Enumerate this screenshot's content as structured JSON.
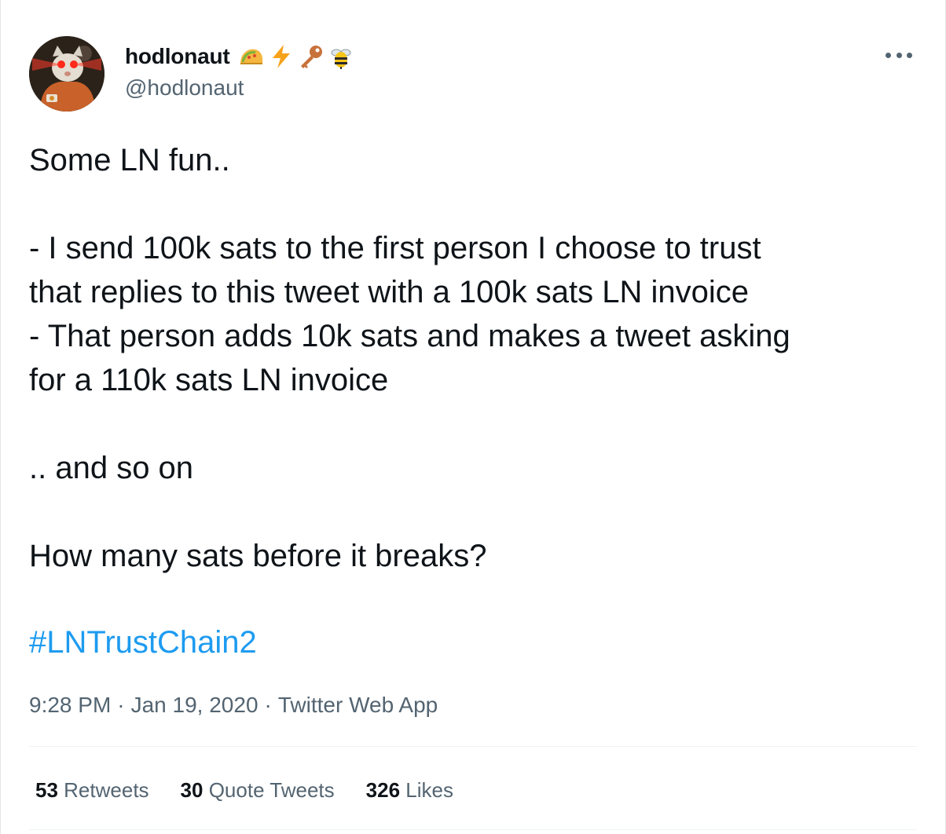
{
  "tweet": {
    "author": {
      "display_name": "hodlonaut",
      "handle": "@hodlonaut",
      "name_emojis": [
        "taco-icon",
        "lightning-icon",
        "key-icon",
        "bee-icon"
      ]
    },
    "lines": [
      "Some LN fun..",
      "",
      "- I send 100k sats to the first person I choose to trust",
      "that replies to this tweet with a 100k sats LN invoice",
      "- That person adds 10k sats and makes a tweet asking",
      "for a 110k sats LN invoice",
      "",
      ".. and so on",
      "",
      "How many sats before it breaks?"
    ],
    "hashtag": "#LNTrustChain2",
    "time": "9:28 PM",
    "date": "Jan 19, 2020",
    "source": "Twitter Web App",
    "separator": "·",
    "stats": {
      "retweets_count": "53",
      "retweets_label": "Retweets",
      "quotes_count": "30",
      "quotes_label": "Quote Tweets",
      "likes_count": "326",
      "likes_label": "Likes"
    }
  },
  "colors": {
    "accent": "#1d9bf0",
    "text": "#0f1419",
    "muted": "#536471"
  }
}
